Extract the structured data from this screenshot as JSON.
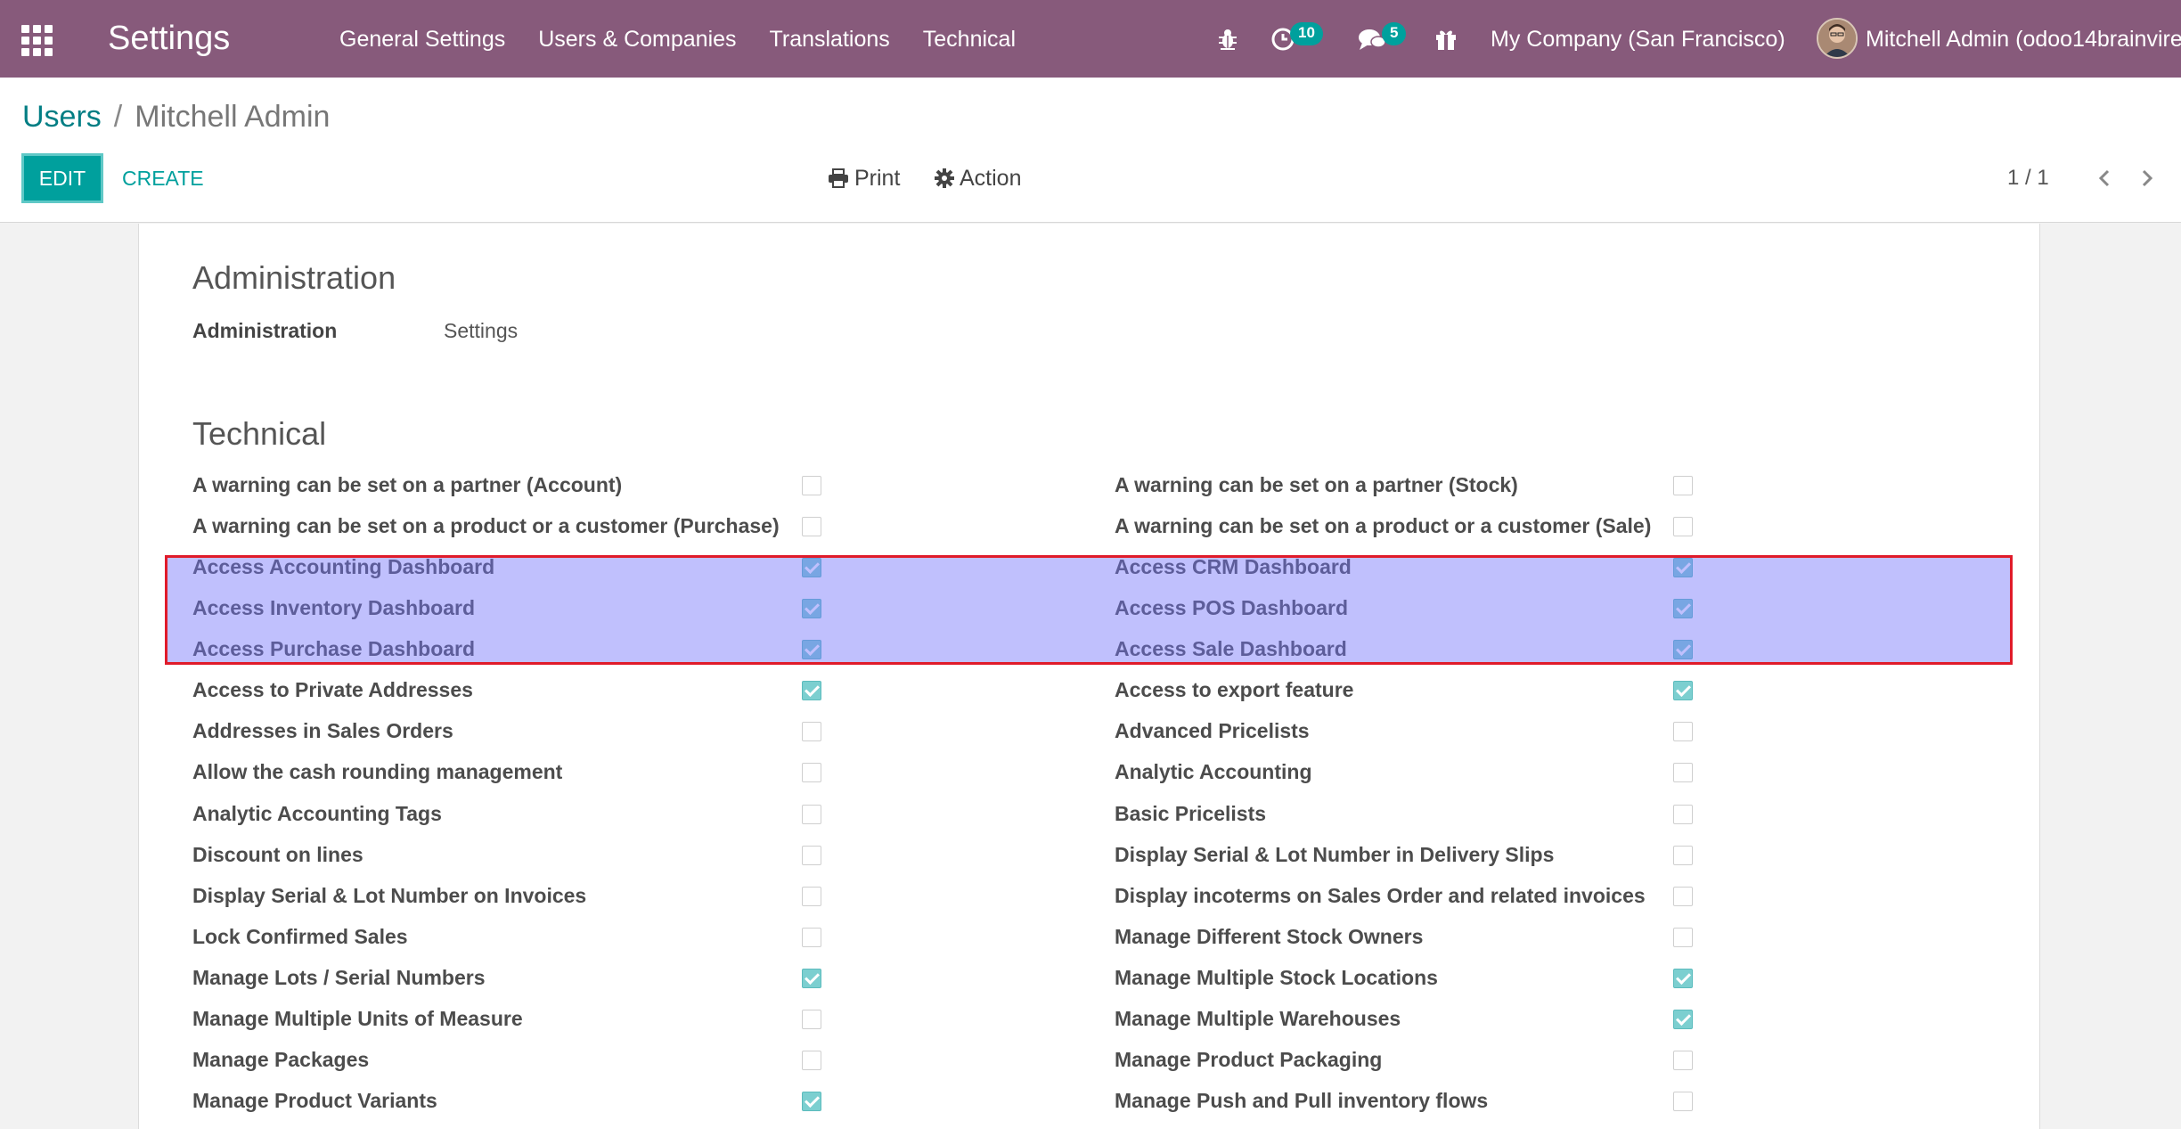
{
  "navbar": {
    "brand": "Settings",
    "menu": [
      "General Settings",
      "Users & Companies",
      "Translations",
      "Technical"
    ],
    "activities_count": "10",
    "messages_count": "5",
    "company": "My Company (San Francisco)",
    "user": "Mitchell Admin (odoo14brainvire"
  },
  "breadcrumb": {
    "parent": "Users",
    "separator": "/",
    "current": "Mitchell Admin"
  },
  "toolbar": {
    "edit_label": "EDIT",
    "create_label": "CREATE",
    "print_label": "Print",
    "action_label": "Action"
  },
  "pager": {
    "value": "1 / 1"
  },
  "administration": {
    "title": "Administration",
    "label": "Administration",
    "value": "Settings"
  },
  "technical": {
    "title": "Technical",
    "rows": [
      {
        "left": {
          "label": "A warning can be set on a partner (Account)",
          "checked": false
        },
        "right": {
          "label": "A warning can be set on a partner (Stock)",
          "checked": false
        }
      },
      {
        "left": {
          "label": "A warning can be set on a product or a customer (Purchase)",
          "checked": false
        },
        "right": {
          "label": "A warning can be set on a product or a customer (Sale)",
          "checked": false
        }
      },
      {
        "left": {
          "label": "Access Accounting Dashboard",
          "checked": true
        },
        "right": {
          "label": "Access CRM Dashboard",
          "checked": true
        }
      },
      {
        "left": {
          "label": "Access Inventory Dashboard",
          "checked": true
        },
        "right": {
          "label": "Access POS Dashboard",
          "checked": true
        }
      },
      {
        "left": {
          "label": "Access Purchase Dashboard",
          "checked": true
        },
        "right": {
          "label": "Access Sale Dashboard",
          "checked": true
        }
      },
      {
        "left": {
          "label": "Access to Private Addresses",
          "checked": true
        },
        "right": {
          "label": "Access to export feature",
          "checked": true
        }
      },
      {
        "left": {
          "label": "Addresses in Sales Orders",
          "checked": false
        },
        "right": {
          "label": "Advanced Pricelists",
          "checked": false
        }
      },
      {
        "left": {
          "label": "Allow the cash rounding management",
          "checked": false
        },
        "right": {
          "label": "Analytic Accounting",
          "checked": false
        }
      },
      {
        "left": {
          "label": "Analytic Accounting Tags",
          "checked": false
        },
        "right": {
          "label": "Basic Pricelists",
          "checked": false
        }
      },
      {
        "left": {
          "label": "Discount on lines",
          "checked": false
        },
        "right": {
          "label": "Display Serial & Lot Number in Delivery Slips",
          "checked": false
        }
      },
      {
        "left": {
          "label": "Display Serial & Lot Number on Invoices",
          "checked": false
        },
        "right": {
          "label": "Display incoterms on Sales Order and related invoices",
          "checked": false
        }
      },
      {
        "left": {
          "label": "Lock Confirmed Sales",
          "checked": false
        },
        "right": {
          "label": "Manage Different Stock Owners",
          "checked": false
        }
      },
      {
        "left": {
          "label": "Manage Lots / Serial Numbers",
          "checked": true
        },
        "right": {
          "label": "Manage Multiple Stock Locations",
          "checked": true
        }
      },
      {
        "left": {
          "label": "Manage Multiple Units of Measure",
          "checked": false
        },
        "right": {
          "label": "Manage Multiple Warehouses",
          "checked": true
        }
      },
      {
        "left": {
          "label": "Manage Packages",
          "checked": false
        },
        "right": {
          "label": "Manage Product Packaging",
          "checked": false
        }
      },
      {
        "left": {
          "label": "Manage Product Variants",
          "checked": true
        },
        "right": {
          "label": "Manage Push and Pull inventory flows",
          "checked": false
        }
      }
    ]
  },
  "icons": {
    "apps": "apps-grid-icon",
    "debug": "bug-icon",
    "activities": "clock-icon",
    "messages": "chat-icon",
    "gift": "gift-icon",
    "print": "printer-icon",
    "action": "gear-icon",
    "prev": "chevron-left-icon",
    "next": "chevron-right-icon"
  },
  "colors": {
    "navbar": "#875a7b",
    "primary": "#00a09d",
    "link": "#017e84",
    "highlight": "#7373fa",
    "highlight_border": "#e01b2a"
  }
}
